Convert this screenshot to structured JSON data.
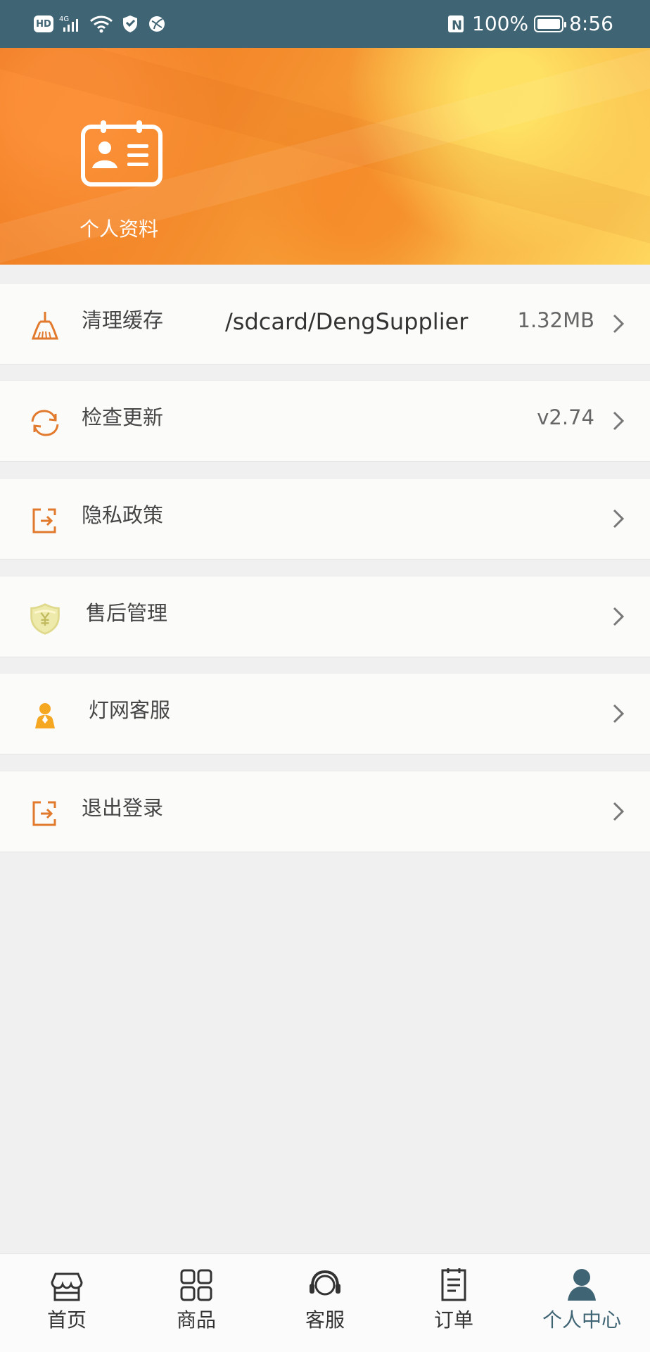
{
  "status_bar": {
    "left_icons": [
      "hd-icon",
      "4g-icon",
      "signal-icon",
      "wifi-icon",
      "shield-icon",
      "globe-icon"
    ],
    "nfc": "N",
    "battery_percent": "100%",
    "battery_level": 1.0,
    "time": "8:56"
  },
  "header": {
    "profile_label": "个人资料",
    "profile_icon": "id-card-icon",
    "colors": [
      "#f07a21",
      "#f7a83c",
      "#fed65e"
    ]
  },
  "menu": {
    "clear_cache": {
      "icon": "broom-icon",
      "label": "清理缓存",
      "path": "/sdcard/DengSupplier",
      "value": "1.32MB"
    },
    "check_update": {
      "icon": "refresh-icon",
      "label": "检查更新",
      "value": "v2.74"
    },
    "privacy_policy": {
      "icon": "logout-icon",
      "label": "隐私政策"
    },
    "after_sales": {
      "icon": "yuan-shield-icon",
      "label": "售后管理"
    },
    "customer_service": {
      "icon": "person-icon",
      "label": "灯网客服"
    },
    "logout": {
      "icon": "logout-icon",
      "label": "退出登录"
    },
    "chevron_icon": "chevron-right-icon",
    "colors": {
      "row_background": "#fbfbfa",
      "accent": "#e27a2e",
      "text": "#454545"
    }
  },
  "bottom_nav": [
    {
      "icon": "store-icon",
      "label": "首页"
    },
    {
      "icon": "grid-icon",
      "label": "商品"
    },
    {
      "icon": "headset-icon",
      "label": "客服"
    },
    {
      "icon": "document-icon",
      "label": "订单"
    },
    {
      "icon": "user-icon",
      "label": "个人中心",
      "active": true
    }
  ],
  "colors": {
    "status_bar": "#3f6474",
    "page_background": "#f0f0f0",
    "active_nav": "#3f6474"
  }
}
